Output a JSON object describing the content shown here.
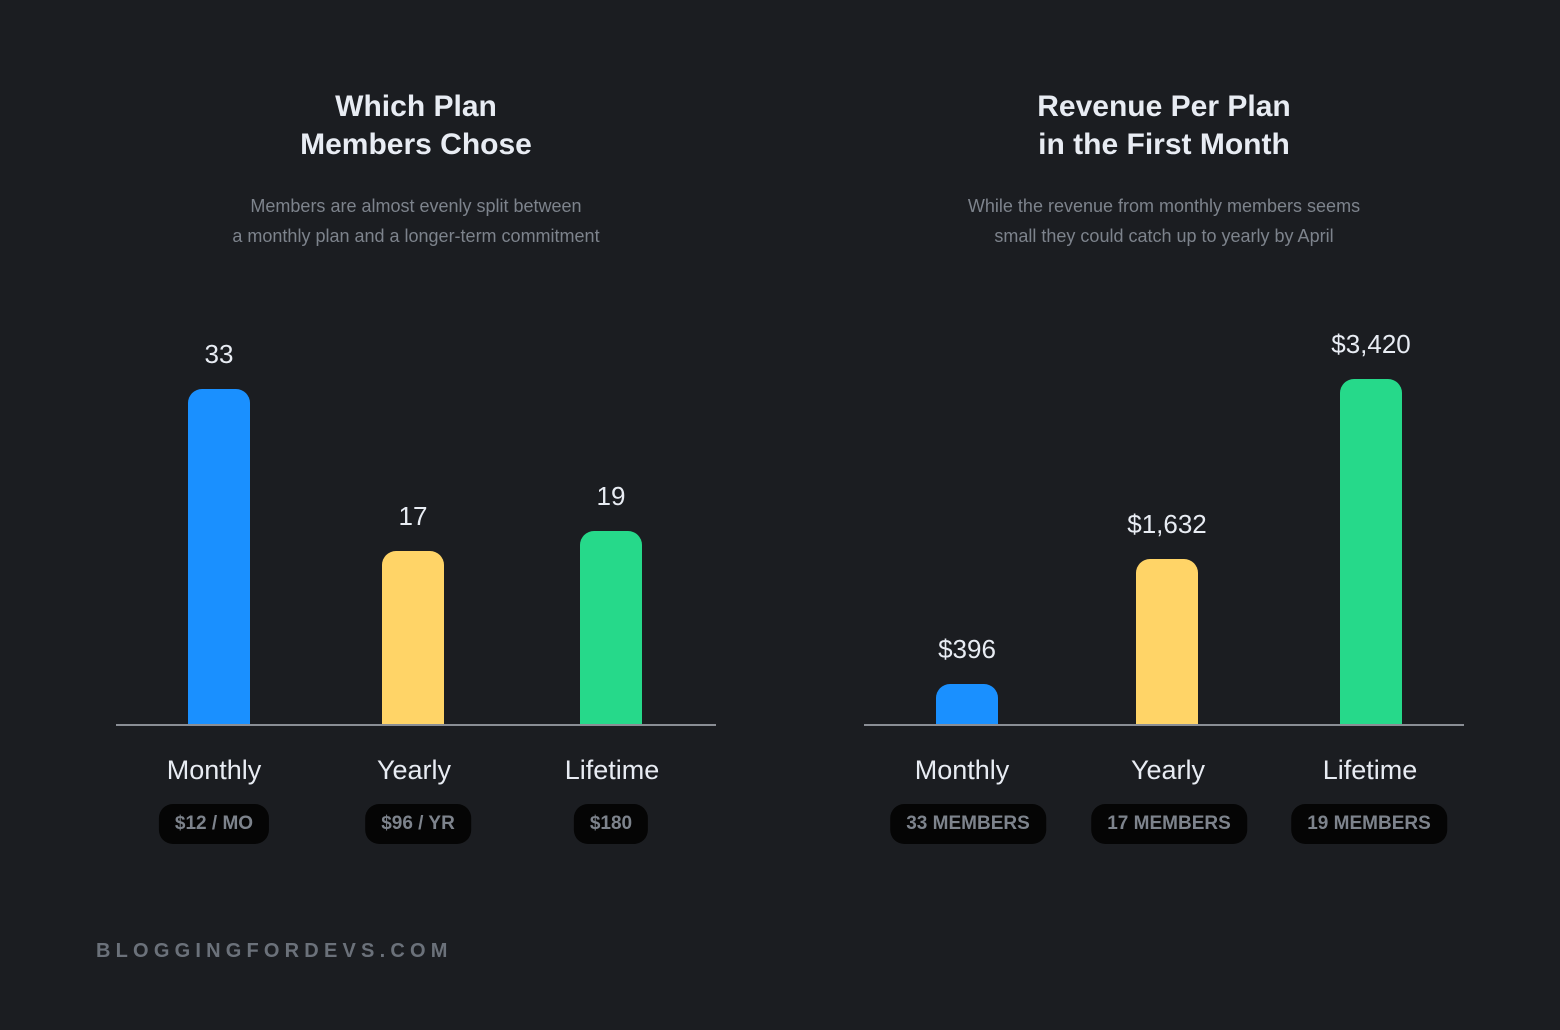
{
  "colors": {
    "background": "#1b1d21",
    "monthly": "#1a90ff",
    "yearly": "#ffd467",
    "lifetime": "#26d98a",
    "baseline": "#8a8e95",
    "pill_bg": "#050505",
    "muted_text": "#7d838c"
  },
  "footer": {
    "brand": "BLOGGINGFORDEVS.COM"
  },
  "chart_data": [
    {
      "type": "bar",
      "title": [
        "Which Plan",
        "Members Chose"
      ],
      "subtitle": [
        "Members are almost evenly split between",
        "a monthly plan and a longer-term commitment"
      ],
      "categories": [
        "Monthly",
        "Yearly",
        "Lifetime"
      ],
      "values": [
        33,
        17,
        19
      ],
      "value_labels": [
        "33",
        "17",
        "19"
      ],
      "pills": [
        "$12 / MO",
        "$96 / YR",
        "$180"
      ],
      "colors": [
        "#1a90ff",
        "#ffd467",
        "#26d98a"
      ],
      "ylim": [
        0,
        34
      ],
      "xlabel": "",
      "ylabel": "",
      "grid": false
    },
    {
      "type": "bar",
      "title": [
        "Revenue Per Plan",
        "in the First Month"
      ],
      "subtitle": [
        "While the revenue from monthly members seems",
        "small they could catch up to yearly by April"
      ],
      "categories": [
        "Monthly",
        "Yearly",
        "Lifetime"
      ],
      "values": [
        396,
        1632,
        3420
      ],
      "value_labels": [
        "$396",
        "$1,632",
        "$3,420"
      ],
      "pills": [
        "33 MEMBERS",
        "17 MEMBERS",
        "19 MEMBERS"
      ],
      "colors": [
        "#1a90ff",
        "#ffd467",
        "#26d98a"
      ],
      "ylim": [
        0,
        3500
      ],
      "xlabel": "",
      "ylabel": "",
      "grid": false
    }
  ]
}
